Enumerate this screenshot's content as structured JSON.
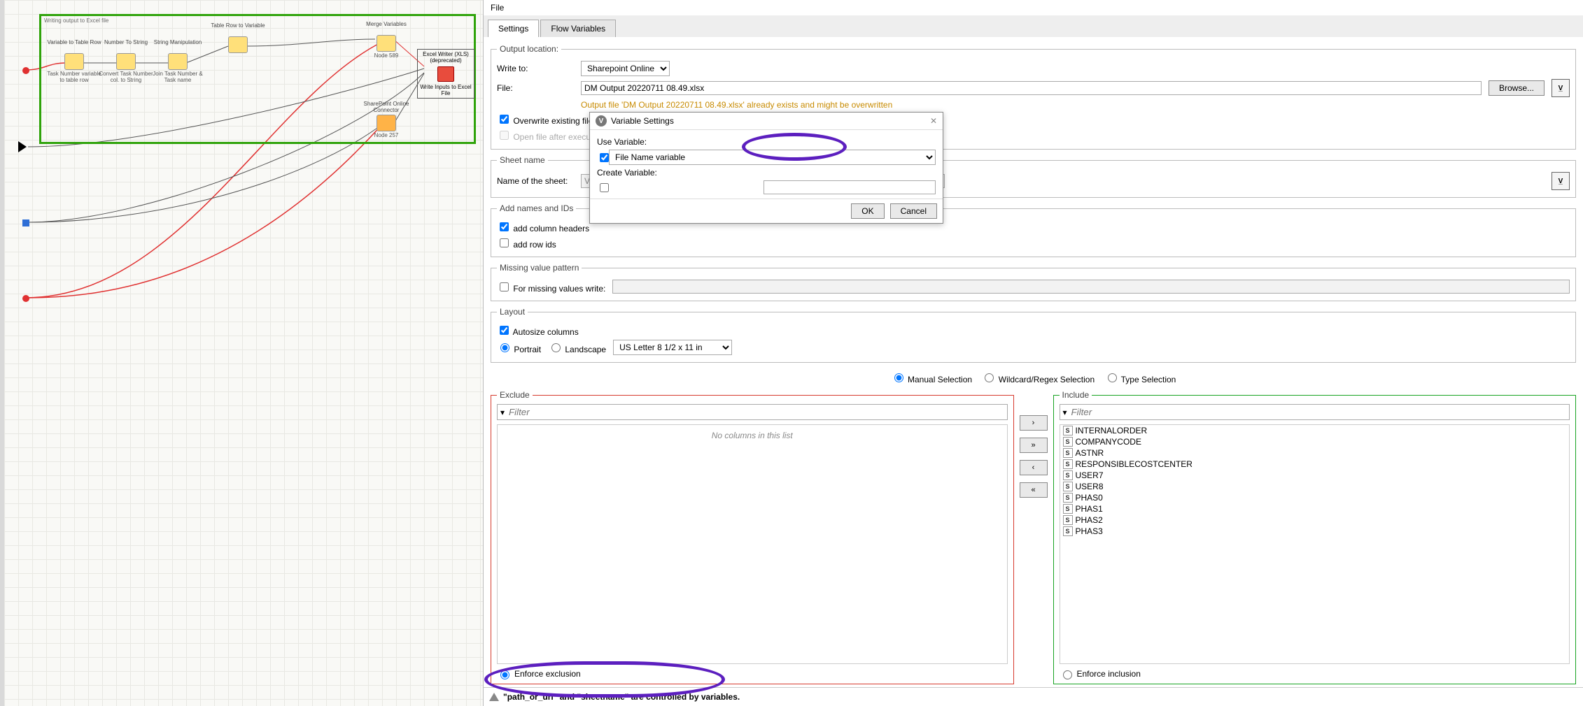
{
  "workflow": {
    "frame_title": "Writing output to Excel file",
    "nodes": {
      "var_to_row": {
        "label": "Variable to\nTable Row",
        "footer": "Task Number variable\nto table row"
      },
      "num_to_str": {
        "label": "Number To String",
        "footer": "Convert Task Number col.\nto String"
      },
      "str_manip": {
        "label": "String Manipulation",
        "footer": "Join Task Number\n& Task name"
      },
      "row_to_var": {
        "label": "Table Row\nto Variable",
        "footer": ""
      },
      "merge_vars": {
        "label": "Merge Variables",
        "footer": "Node 589"
      },
      "sp_connector": {
        "label": "SharePoint\nOnline Connector",
        "footer": "Node 257"
      },
      "xls_writer": {
        "label": "Excel Writer (XLS)\n(deprecated)",
        "footer": "Write Inputs to Excel File"
      }
    }
  },
  "menu": {
    "file": "File"
  },
  "tabs": {
    "settings": "Settings",
    "flow_vars": "Flow Variables"
  },
  "output_loc": {
    "legend": "Output location:",
    "write_to_label": "Write to:",
    "write_to_value": "Sharepoint Online",
    "file_label": "File:",
    "file_value": "DM Output 20220711 08.49.xlsx",
    "browse": "Browse...",
    "warn": "Output file 'DM Output 20220711 08.49.xlsx' already exists and might be overwritten",
    "overwrite": "Overwrite existing file",
    "open_after": "Open file after execution"
  },
  "sheet": {
    "legend": "Sheet name",
    "name_label": "Name of the sheet:",
    "name_value": "Variable Inp"
  },
  "names_ids": {
    "legend": "Add names and IDs",
    "add_col": "add column headers",
    "add_row": "add row ids"
  },
  "missing": {
    "legend": "Missing value pattern",
    "label": "For missing values write:"
  },
  "layout": {
    "legend": "Layout",
    "autosize": "Autosize columns",
    "portrait": "Portrait",
    "landscape": "Landscape",
    "paper": "US Letter 8 1/2 x 11 in"
  },
  "var_modal": {
    "title": "Variable Settings",
    "use_var": "Use Variable:",
    "create_var": "Create Variable:",
    "selected": "File Name variable",
    "ok": "OK",
    "cancel": "Cancel"
  },
  "selection": {
    "manual": "Manual Selection",
    "regex": "Wildcard/Regex Selection",
    "type": "Type Selection",
    "exclude_legend": "Exclude",
    "include_legend": "Include",
    "filter_ph": "Filter",
    "empty": "No columns in this list",
    "enforce_ex": "Enforce exclusion",
    "enforce_in": "Enforce inclusion",
    "include_cols": [
      "INTERNALORDER",
      "COMPANYCODE",
      "ASTNR",
      "RESPONSIBLECOSTCENTER",
      "USER7",
      "USER8",
      "PHAS0",
      "PHAS1",
      "PHAS2",
      "PHAS3"
    ]
  },
  "status": {
    "text": "\"path_or_url\" and \"sheetname\" are controlled by variables."
  }
}
